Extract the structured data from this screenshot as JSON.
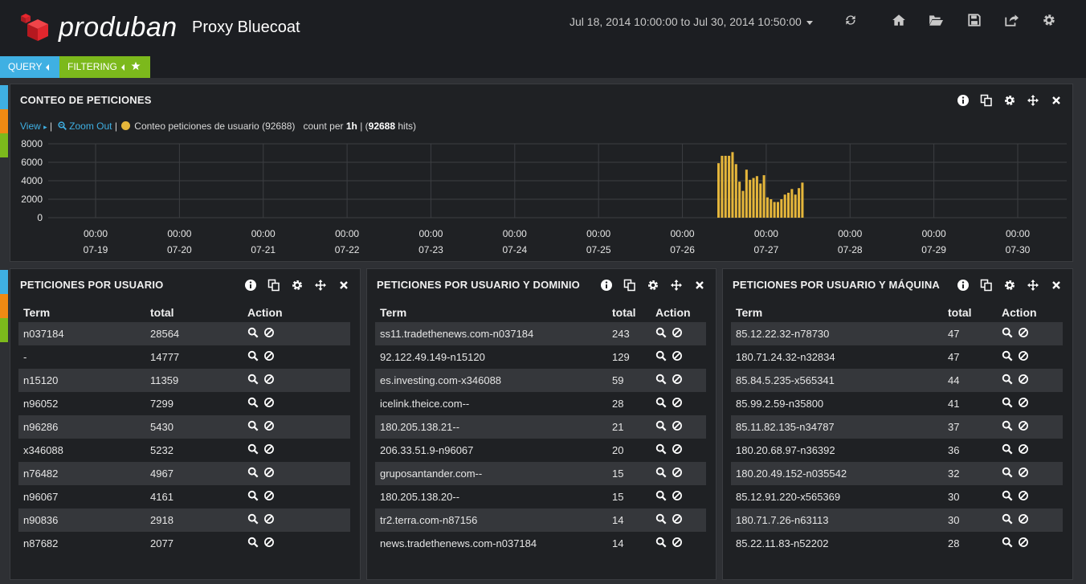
{
  "header": {
    "brand": "produban",
    "app_title": "Proxy Bluecoat",
    "time_range": "Jul 18, 2014 10:00:00 to Jul 30, 2014 10:50:00"
  },
  "pills": {
    "query": "QUERY",
    "filtering": "FILTERING"
  },
  "histogram": {
    "title": "CONTEO DE PETICIONES",
    "view_label": "View",
    "zoom_label": "Zoom Out",
    "series_label": "Conteo peticiones de usuario (92688)",
    "count_per": "count per",
    "interval": "1h",
    "hits_total": "92688",
    "hits_word": "hits"
  },
  "chart_data": {
    "type": "bar",
    "y_ticks": [
      "8000",
      "6000",
      "4000",
      "2000",
      "0"
    ],
    "ylim": [
      0,
      8000
    ],
    "x_ticks": [
      {
        "time": "00:00",
        "date": "07-19"
      },
      {
        "time": "00:00",
        "date": "07-20"
      },
      {
        "time": "00:00",
        "date": "07-21"
      },
      {
        "time": "00:00",
        "date": "07-22"
      },
      {
        "time": "00:00",
        "date": "07-23"
      },
      {
        "time": "00:00",
        "date": "07-24"
      },
      {
        "time": "00:00",
        "date": "07-25"
      },
      {
        "time": "00:00",
        "date": "07-26"
      },
      {
        "time": "00:00",
        "date": "07-27"
      },
      {
        "time": "00:00",
        "date": "07-28"
      },
      {
        "time": "00:00",
        "date": "07-29"
      },
      {
        "time": "00:00",
        "date": "07-30"
      }
    ],
    "bar_color": "#e5b63b",
    "series": [
      {
        "points": [
          {
            "x": "2014-07-26 10:00",
            "y": 5900
          },
          {
            "x": "2014-07-26 11:00",
            "y": 6700
          },
          {
            "x": "2014-07-26 12:00",
            "y": 6700
          },
          {
            "x": "2014-07-26 13:00",
            "y": 6700
          },
          {
            "x": "2014-07-26 14:00",
            "y": 7100
          },
          {
            "x": "2014-07-26 15:00",
            "y": 5800
          },
          {
            "x": "2014-07-26 16:00",
            "y": 3900
          },
          {
            "x": "2014-07-26 17:00",
            "y": 2900
          },
          {
            "x": "2014-07-26 18:00",
            "y": 5200
          },
          {
            "x": "2014-07-26 19:00",
            "y": 4100
          },
          {
            "x": "2014-07-26 20:00",
            "y": 4300
          },
          {
            "x": "2014-07-26 21:00",
            "y": 4500
          },
          {
            "x": "2014-07-26 22:00",
            "y": 3700
          },
          {
            "x": "2014-07-26 23:00",
            "y": 4600
          },
          {
            "x": "2014-07-27 00:00",
            "y": 2200
          },
          {
            "x": "2014-07-27 01:00",
            "y": 2000
          },
          {
            "x": "2014-07-27 02:00",
            "y": 1700
          },
          {
            "x": "2014-07-27 03:00",
            "y": 1700
          },
          {
            "x": "2014-07-27 04:00",
            "y": 2000
          },
          {
            "x": "2014-07-27 05:00",
            "y": 2500
          },
          {
            "x": "2014-07-27 06:00",
            "y": 2700
          },
          {
            "x": "2014-07-27 07:00",
            "y": 3100
          },
          {
            "x": "2014-07-27 08:00",
            "y": 2500
          },
          {
            "x": "2014-07-27 09:00",
            "y": 3200
          },
          {
            "x": "2014-07-27 10:00",
            "y": 3800
          }
        ]
      }
    ]
  },
  "tables": [
    {
      "title": "PETICIONES POR USUARIO",
      "headers": [
        "Term",
        "total",
        "Action"
      ],
      "rows": [
        [
          "n037184",
          "28564"
        ],
        [
          "-",
          "14777"
        ],
        [
          "n15120",
          "11359"
        ],
        [
          "n96052",
          "7299"
        ],
        [
          "n96286",
          "5430"
        ],
        [
          "x346088",
          "5232"
        ],
        [
          "n76482",
          "4967"
        ],
        [
          "n96067",
          "4161"
        ],
        [
          "n90836",
          "2918"
        ],
        [
          "n87682",
          "2077"
        ]
      ]
    },
    {
      "title": "PETICIONES POR USUARIO Y DOMINIO",
      "headers": [
        "Term",
        "total",
        "Action"
      ],
      "rows": [
        [
          "ss11.tradethenews.com-n037184",
          "243"
        ],
        [
          "92.122.49.149-n15120",
          "129"
        ],
        [
          "es.investing.com-x346088",
          "59"
        ],
        [
          "icelink.theice.com--",
          "28"
        ],
        [
          "180.205.138.21--",
          "21"
        ],
        [
          "206.33.51.9-n96067",
          "20"
        ],
        [
          "gruposantander.com--",
          "15"
        ],
        [
          "180.205.138.20--",
          "15"
        ],
        [
          "tr2.terra.com-n87156",
          "14"
        ],
        [
          "news.tradethenews.com-n037184",
          "14"
        ]
      ]
    },
    {
      "title": "PETICIONES POR USUARIO Y MÁQUINA",
      "headers": [
        "Term",
        "total",
        "Action"
      ],
      "rows": [
        [
          "85.12.22.32-n78730",
          "47"
        ],
        [
          "180.71.24.32-n32834",
          "47"
        ],
        [
          "85.84.5.235-x565341",
          "44"
        ],
        [
          "85.99.2.59-n35800",
          "41"
        ],
        [
          "85.11.82.135-n34787",
          "37"
        ],
        [
          "180.20.68.97-n36392",
          "36"
        ],
        [
          "180.20.49.152-n035542",
          "32"
        ],
        [
          "85.12.91.220-x565369",
          "30"
        ],
        [
          "180.71.7.26-n63113",
          "30"
        ],
        [
          "85.22.11.83-n52202",
          "28"
        ]
      ]
    }
  ]
}
